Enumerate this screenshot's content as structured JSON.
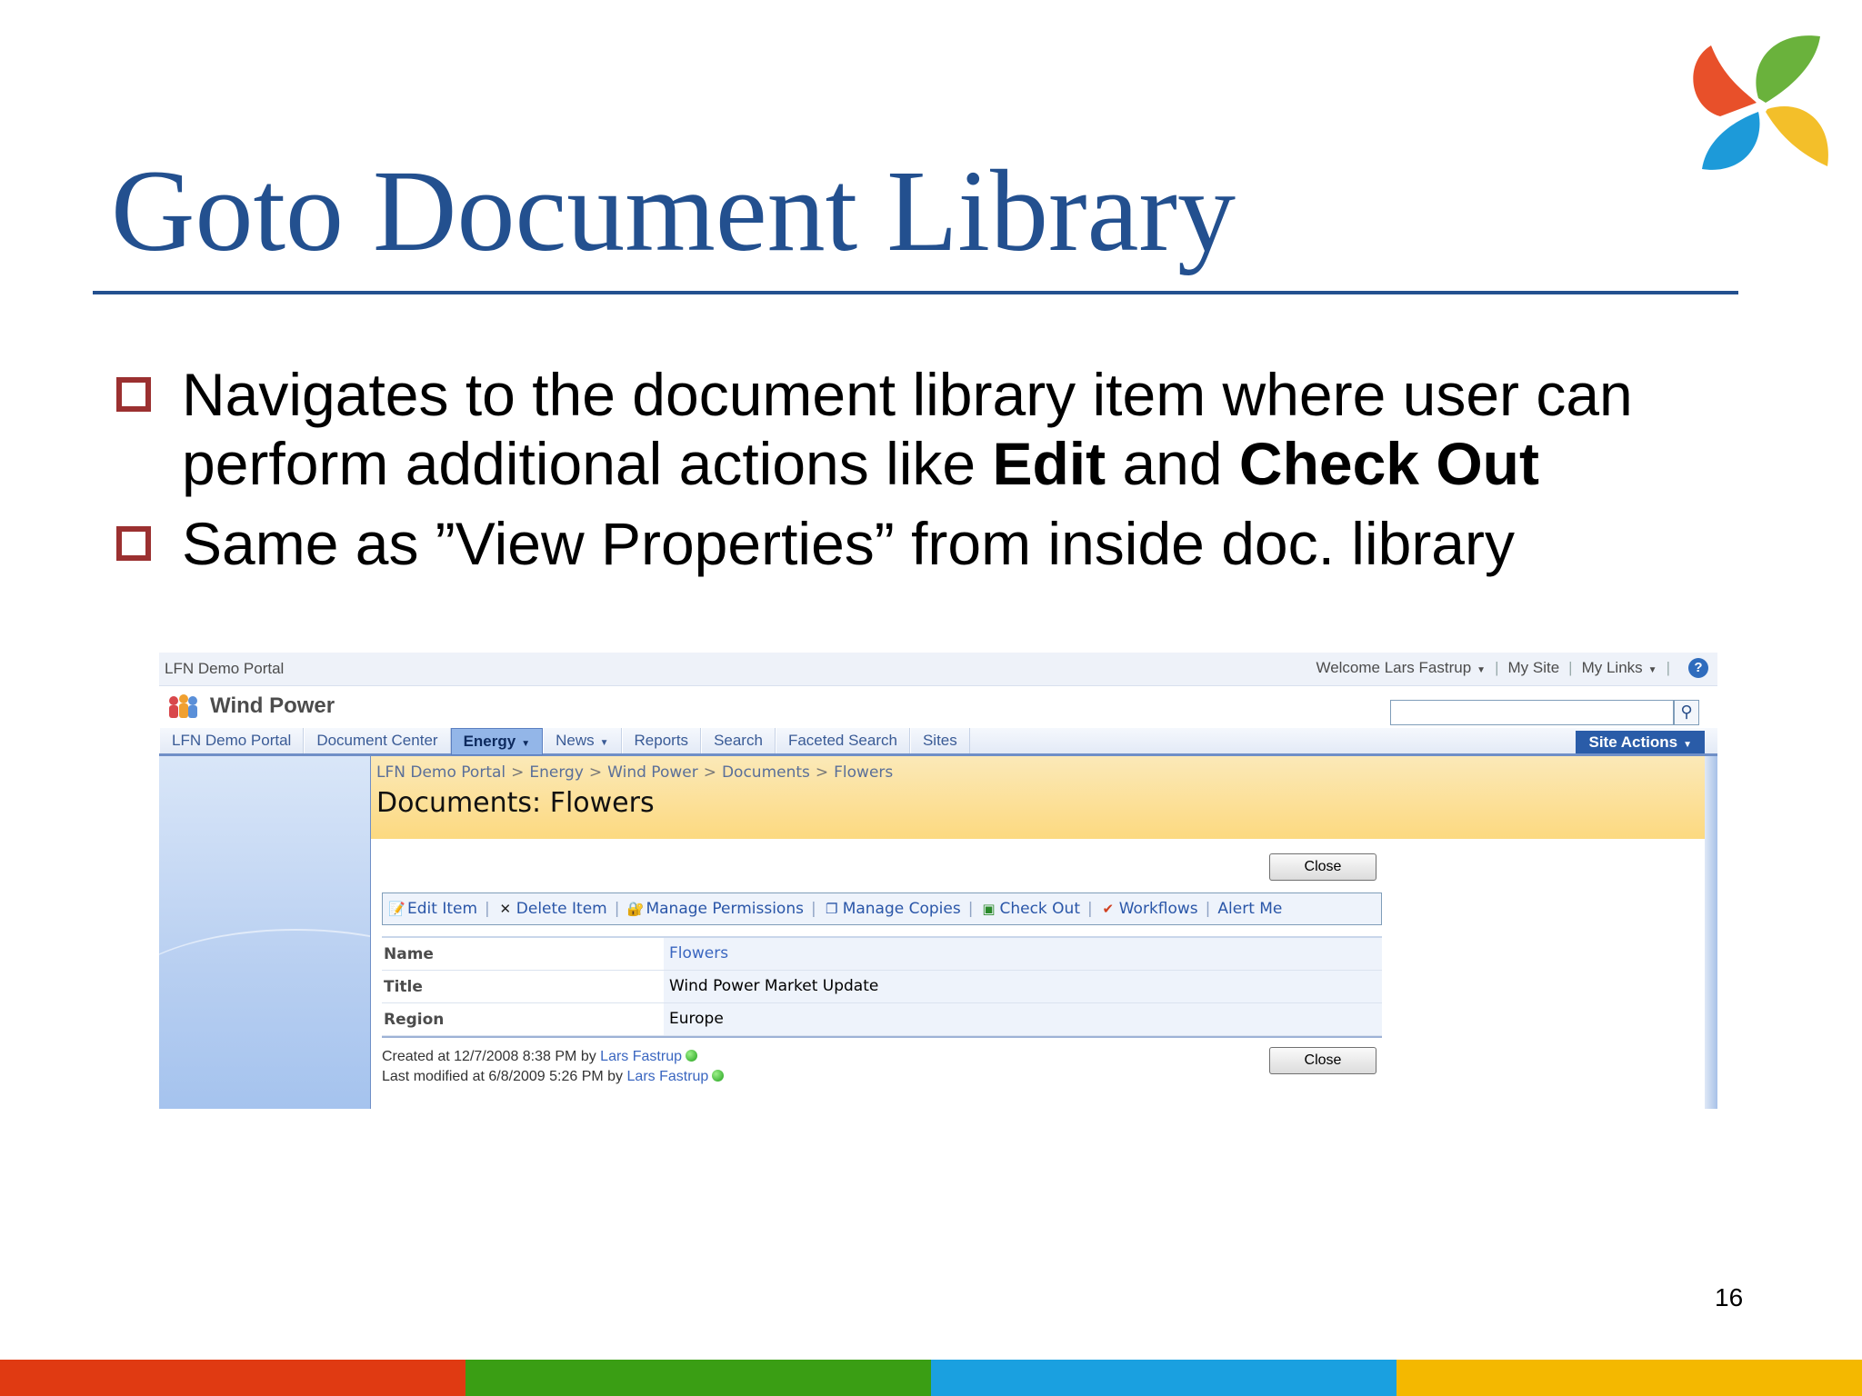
{
  "slide": {
    "title": "Goto Document Library",
    "bullets": [
      {
        "parts": [
          {
            "text": "Navigates to the document library item where user can perform additional actions like ",
            "bold": false
          },
          {
            "text": "Edit",
            "bold": true
          },
          {
            "text": " and ",
            "bold": false
          },
          {
            "text": "Check Out",
            "bold": true
          }
        ]
      },
      {
        "parts": [
          {
            "text": "Same as ”View Properties” from inside doc. library",
            "bold": false
          }
        ]
      }
    ],
    "page_number": "16",
    "colors": {
      "title": "#23508f",
      "bullet_marker": "#9b3030",
      "footer": [
        "#e03a12",
        "#3a9e14",
        "#1aa0e0",
        "#f4b800"
      ]
    },
    "logo": "four-petal-pinwheel-logo"
  },
  "screenshot": {
    "portal_name": "LFN Demo Portal",
    "top_links": {
      "welcome": "Welcome Lars Fastrup",
      "my_site": "My Site",
      "my_links": "My Links",
      "help_icon": "help-icon"
    },
    "site_title": "Wind Power",
    "search": {
      "placeholder": "",
      "icon": "search-icon"
    },
    "tabs": [
      {
        "label": "LFN Demo Portal"
      },
      {
        "label": "Document Center"
      },
      {
        "label": "Energy",
        "active": true,
        "dropdown": true
      },
      {
        "label": "News",
        "dropdown": true
      },
      {
        "label": "Reports"
      },
      {
        "label": "Search"
      },
      {
        "label": "Faceted Search"
      },
      {
        "label": "Sites"
      }
    ],
    "site_actions": "Site Actions",
    "breadcrumb": [
      "LFN Demo Portal",
      "Energy",
      "Wind Power",
      "Documents",
      "Flowers"
    ],
    "breadcrumb_separator": ">",
    "page_heading": "Documents: Flowers",
    "close_label": "Close",
    "toolbar": [
      {
        "label": "Edit Item",
        "icon": "edit-icon"
      },
      {
        "label": "Delete Item",
        "icon": "delete-icon"
      },
      {
        "label": "Manage Permissions",
        "icon": "permissions-icon"
      },
      {
        "label": "Manage Copies",
        "icon": "copies-icon"
      },
      {
        "label": "Check Out",
        "icon": "checkout-icon"
      },
      {
        "label": "Workflows",
        "icon": "workflow-icon"
      },
      {
        "label": "Alert Me",
        "icon": ""
      }
    ],
    "properties": [
      {
        "label": "Name",
        "value": "Flowers",
        "link": true
      },
      {
        "label": "Title",
        "value": "Wind Power Market Update",
        "link": false
      },
      {
        "label": "Region",
        "value": "Europe",
        "link": false
      }
    ],
    "created": {
      "prefix": "Created at 12/7/2008 8:38 PM  by",
      "user": "Lars Fastrup"
    },
    "modified": {
      "prefix": "Last modified at 6/8/2009 5:26 PM  by",
      "user": "Lars Fastrup"
    }
  }
}
